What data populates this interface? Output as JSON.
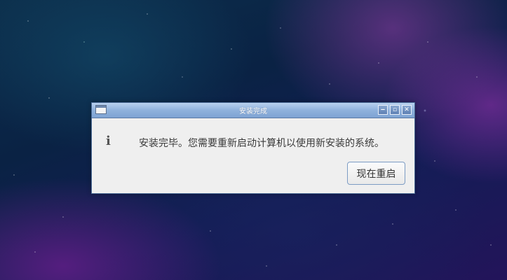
{
  "dialog": {
    "title": "安装完成",
    "message": "安装完毕。您需要重新启动计算机以使用新安装的系统。",
    "info_glyph": "i",
    "restart_button_label": "现在重启",
    "window_buttons": {
      "minimize_glyph": "‒",
      "maximize_glyph": "▫",
      "close_glyph": "✕"
    }
  },
  "colors": {
    "titlebar_accent": "#8fb1dc",
    "button_border": "#7c9cc4"
  }
}
